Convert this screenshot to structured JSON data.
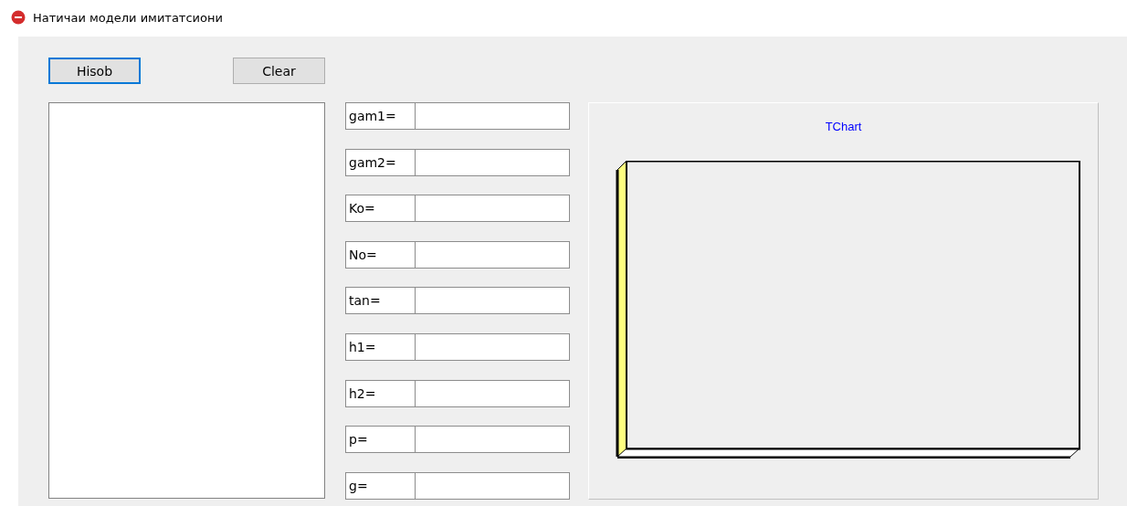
{
  "window": {
    "title": "Натичаи модели имитатсиони"
  },
  "buttons": [
    {
      "label": "Hisob",
      "focused": true
    },
    {
      "label": "Clear",
      "focused": false
    }
  ],
  "fields": [
    {
      "label": "gam1="
    },
    {
      "label": "gam2="
    },
    {
      "label": "Ko="
    },
    {
      "label": "No="
    },
    {
      "label": "tan="
    },
    {
      "label": "h1="
    },
    {
      "label": "h2="
    },
    {
      "label": "p="
    },
    {
      "label": "g="
    }
  ],
  "chart": {
    "title": "TChart"
  }
}
